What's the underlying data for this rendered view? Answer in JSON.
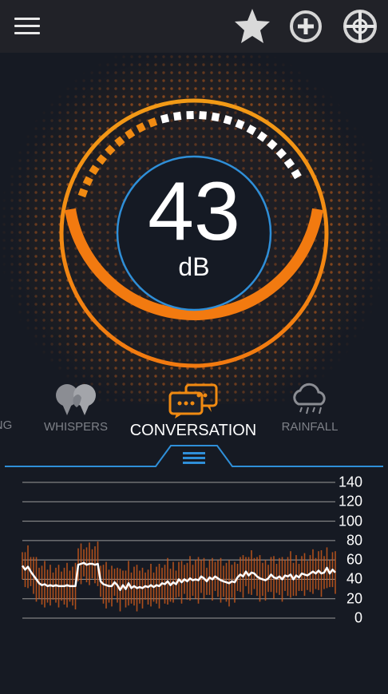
{
  "toolbar": {
    "menu_icon": "hamburger-menu-icon",
    "favorite_icon": "star-icon",
    "add_icon": "plus-circle-icon",
    "calibrate_icon": "crosshair-icon"
  },
  "meter": {
    "value": "43",
    "unit": "dB",
    "level_fraction": 0.43,
    "colors": {
      "arc": "#f08a12",
      "inner_ring": "#2f8fd8",
      "ticks_active": "#f08a12",
      "ticks_idle": "#ffffff"
    }
  },
  "presets": [
    {
      "label": "NG",
      "icon": "partial-icon",
      "state": "dim"
    },
    {
      "label": "WHISPERS",
      "icon": "whisper-icon",
      "state": "dim"
    },
    {
      "label": "CONVERSATION",
      "icon": "conversation-icon",
      "state": "active"
    },
    {
      "label": "RAINFALL",
      "icon": "rain-cloud-icon",
      "state": "dim"
    }
  ],
  "history": {
    "handle_icon": "menu-handle-icon",
    "y_ticks": [
      "140",
      "120",
      "100",
      "80",
      "60",
      "40",
      "20",
      "0"
    ],
    "y_max": 140,
    "line_values": [
      54,
      50,
      53,
      48,
      44,
      40,
      36,
      34,
      35,
      33,
      34,
      33,
      34,
      33,
      33,
      33,
      34,
      33,
      33,
      33,
      55,
      56,
      57,
      55,
      56,
      56,
      55,
      56,
      38,
      35,
      34,
      33,
      33,
      37,
      34,
      29,
      34,
      30,
      36,
      31,
      33,
      31,
      32,
      31,
      33,
      32,
      34,
      32,
      34,
      33,
      36,
      35,
      38,
      34,
      37,
      35,
      40,
      37,
      40,
      38,
      41,
      39,
      40,
      39,
      43,
      41,
      38,
      42,
      40,
      43,
      41,
      39,
      38,
      37,
      36,
      38,
      37,
      42,
      45,
      43,
      48,
      44,
      47,
      46,
      43,
      41,
      40,
      39,
      41,
      45,
      42,
      41,
      43,
      40,
      44,
      43,
      45,
      40,
      44,
      42,
      46,
      45,
      44,
      46,
      48,
      46,
      49,
      46,
      47,
      52,
      46,
      50,
      47
    ],
    "colors": {
      "line": "#ffffff",
      "bars": "#c8581b",
      "grid": "#9a9a9a",
      "accent": "#2f8fd8"
    }
  }
}
